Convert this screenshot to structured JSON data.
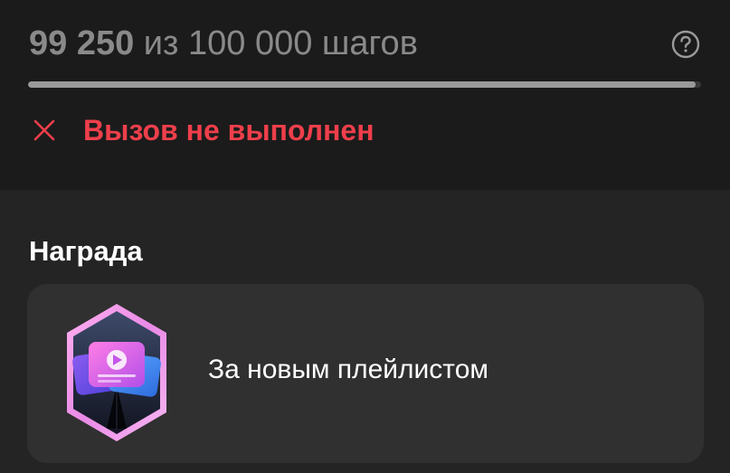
{
  "progress": {
    "steps_done": "99 250",
    "steps_rest": " из 100 000 шагов",
    "value": 99250,
    "goal": 100000,
    "fraction": 0.9925
  },
  "help": {
    "icon": "question-circle-icon"
  },
  "status": {
    "icon": "close-x-icon",
    "text": "Вызов не выполнен",
    "color": "#ee3f4b"
  },
  "reward": {
    "heading": "Награда",
    "badge_icon": "playlist-badge-icon",
    "title": "За новым плейлистом"
  }
}
